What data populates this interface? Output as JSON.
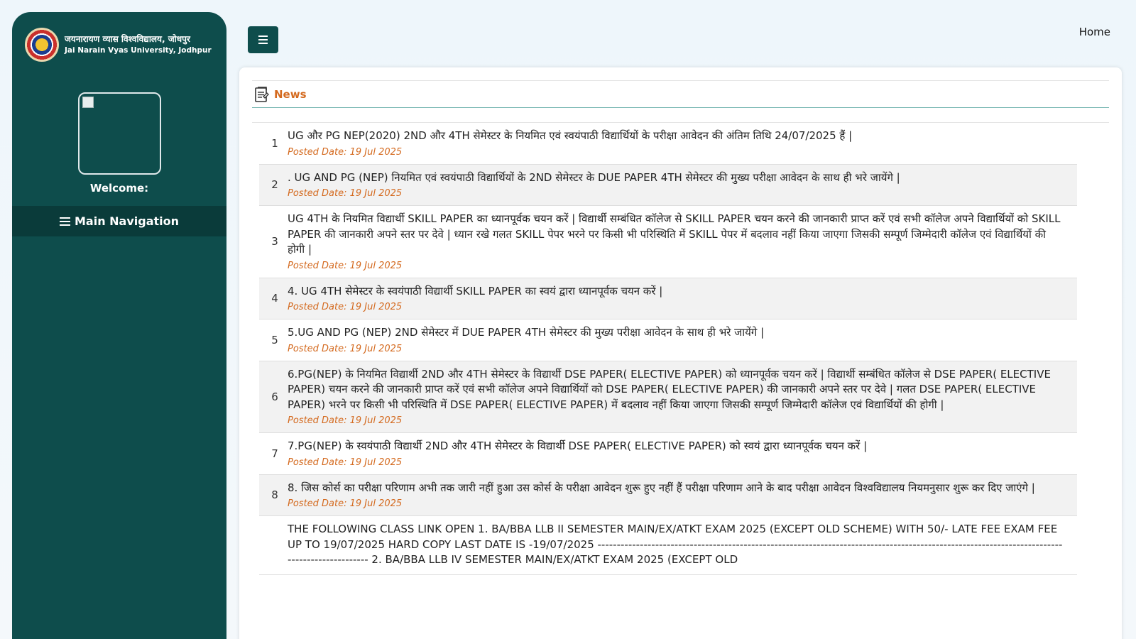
{
  "university": {
    "name_hi": "जयनारायण व्यास विश्वविद्यालय, जोधपुर",
    "name_en": "Jai Narain Vyas University, Jodhpur"
  },
  "sidebar": {
    "welcome": "Welcome:",
    "main_nav": "Main Navigation"
  },
  "topbar": {
    "home": "Home"
  },
  "news": {
    "title": "News",
    "items": [
      {
        "num": "1",
        "text": "UG और PG NEP(2020) 2ND और 4TH सेमेस्टर के नियमित एवं स्वयंपाठी विद्यार्थियों के परीक्षा आवेदन की अंतिम तिथि 24/07/2025 हैं |",
        "date": "Posted Date: 19 Jul 2025"
      },
      {
        "num": "2",
        "text": ". UG AND PG (NEP) नियमित एवं स्वयंपाठी विद्यार्थियों के 2ND सेमेस्टर के DUE PAPER 4TH सेमेस्टर की मुख्य परीक्षा आवेदन के साथ ही भरे जायेंगे |",
        "date": "Posted Date: 19 Jul 2025"
      },
      {
        "num": "3",
        "text": "UG 4TH के नियमित विद्यार्थी SKILL PAPER का ध्यानपूर्वक चयन करें | विद्यार्थी सम्बंधित कॉलेज से SKILL PAPER चयन करने की जानकारी प्राप्त करें एवं सभी कॉलेज अपने विद्यार्थियों को SKILL PAPER की जानकारी अपने स्तर पर देवे | ध्यान रखे गलत SKILL पेपर भरने पर किसी भी परिस्थिति में SKILL पेपर में बदलाव नहीं किया जाएगा जिसकी सम्पूर्ण जिम्मेदारी कॉलेज एवं विद्यार्थियों की होगी |",
        "date": "Posted Date: 19 Jul 2025"
      },
      {
        "num": "4",
        "text": "4. UG 4TH सेमेस्टर के स्वयंपाठी विद्यार्थी SKILL PAPER का स्वयं द्वारा ध्यानपूर्वक चयन करें |",
        "date": "Posted Date: 19 Jul 2025"
      },
      {
        "num": "5",
        "text": "5.UG AND PG (NEP) 2ND सेमेस्टर में DUE PAPER 4TH सेमेस्टर की मुख्य परीक्षा आवेदन के साथ ही भरे जायेंगे |",
        "date": "Posted Date: 19 Jul 2025"
      },
      {
        "num": "6",
        "text": "6.PG(NEP) के नियमित विद्यार्थी 2ND और 4TH सेमेस्टर के विद्यार्थी DSE PAPER( ELECTIVE PAPER) को ध्यानपूर्वक चयन करें | विद्यार्थी सम्बंधित कॉलेज से DSE PAPER( ELECTIVE PAPER) चयन करने की जानकारी प्राप्त करें एवं सभी कॉलेज अपने विद्यार्थियों को DSE PAPER( ELECTIVE PAPER) की जानकारी अपने स्तर पर देवे | गलत DSE PAPER( ELECTIVE PAPER) भरने पर किसी भी परिस्थिति में DSE PAPER( ELECTIVE PAPER) में बदलाव नहीं किया जाएगा जिसकी सम्पूर्ण जिम्मेदारी कॉलेज एवं विद्यार्थियों की होगी |",
        "date": "Posted Date: 19 Jul 2025"
      },
      {
        "num": "7",
        "text": "7.PG(NEP) के स्वयंपाठी विद्यार्थी 2ND और 4TH सेमेस्टर के विद्यार्थी DSE PAPER( ELECTIVE PAPER) को स्वयं द्वारा ध्यानपूर्वक चयन करें |",
        "date": "Posted Date: 19 Jul 2025"
      },
      {
        "num": "8",
        "text": "8. जिस कोर्स का परीक्षा परिणाम अभी तक जारी नहीं हुआ उस कोर्स के परीक्षा आवेदन शुरू हुए नहीं हैं परीक्षा परिणाम आने के बाद परीक्षा आवेदन विश्वविद्यालय नियमनुसार शुरू कर दिए जाएंगे |",
        "date": "Posted Date: 19 Jul 2025"
      },
      {
        "num": "",
        "text": "THE FOLLOWING CLASS LINK OPEN 1. BA/BBA LLB II SEMESTER MAIN/EX/ATKT EXAM 2025 (EXCEPT OLD SCHEME) WITH 50/- LATE FEE EXAM FEE UP TO 19/07/2025 HARD COPY LAST DATE IS -19/07/2025 ---------------------------------------------------------------------------------------------------------------------------------------------- 2. BA/BBA LLB IV SEMESTER MAIN/EX/ATKT EXAM 2025 (EXCEPT OLD",
        "date": ""
      }
    ]
  }
}
